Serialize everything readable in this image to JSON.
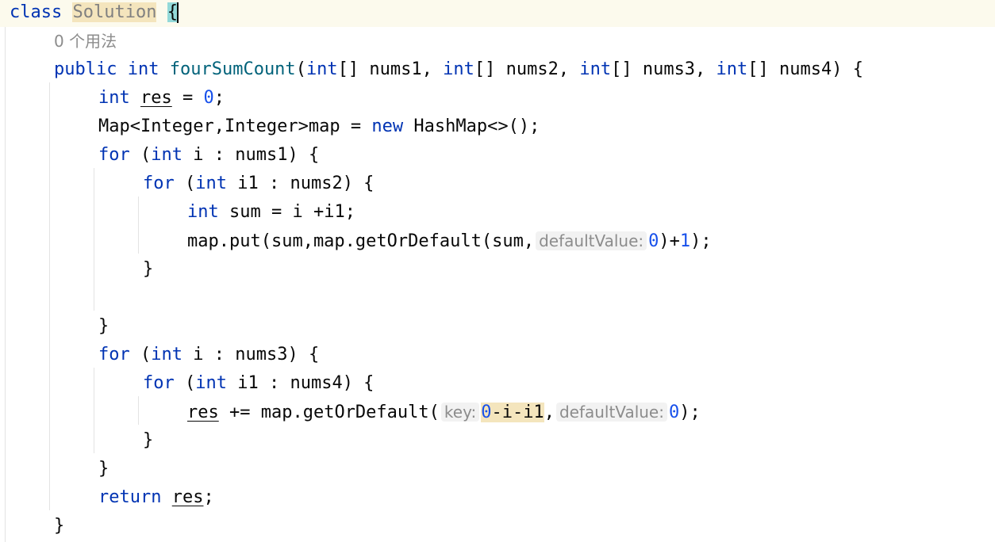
{
  "editor": {
    "lines": [
      {
        "kw": "class",
        "class_name": "Solution",
        "open_brace": "{"
      },
      {
        "usages": "0 个用法"
      },
      {
        "mod": "public",
        "ret": "int",
        "method": "fourSumCount",
        "p_open": "(",
        "t1": "int",
        "a1": "[] nums1, ",
        "t2": "int",
        "a2": "[] nums2, ",
        "t3": "int",
        "a3": "[] nums3, ",
        "t4": "int",
        "a4": "[] nums4) {"
      },
      {
        "type": "int",
        "var": "res",
        "mid": " = ",
        "num": "0",
        "end": ";"
      },
      {
        "pre": "Map<Integer,Integer>map = ",
        "kw": "new",
        "post": " HashMap<>();"
      },
      {
        "kw": "for",
        "p1": " (",
        "type": "int",
        "rest": " i : nums1) {"
      },
      {
        "kw": "for",
        "p1": " (",
        "type": "int",
        "rest": " i1 : nums2) {"
      },
      {
        "type": "int",
        "rest": " sum = i +i1;"
      },
      {
        "pre": "map.put(sum,map.getOrDefault(sum,",
        "hint": "defaultValue:",
        "num1": "0",
        "mid": ")+",
        "num2": "1",
        "end": ");"
      },
      {
        "text": "}"
      },
      {
        "text": ""
      },
      {
        "text": "}"
      },
      {
        "kw": "for",
        "p1": " (",
        "type": "int",
        "rest": " i : nums3) {"
      },
      {
        "kw": "for",
        "p1": " (",
        "type": "int",
        "rest": " i1 : nums4) {"
      },
      {
        "var": "res",
        "pre": " += map.getOrDefault(",
        "hint1": "key:",
        "num1": "0",
        "expr": "-i-i1",
        "comma": ",",
        "hint2": "defaultValue:",
        "num2": "0",
        "end": ");"
      },
      {
        "text": "}"
      },
      {
        "text": "}"
      },
      {
        "kw": "return",
        "var": "res",
        "end": ";"
      },
      {
        "text": "}"
      }
    ]
  },
  "colors": {
    "keyword": "#0033b3",
    "number": "#1750eb",
    "method_declaration": "#00627a",
    "hint_text": "#8c8c8c",
    "hint_background": "#f2f2f2",
    "highlight_background": "#f4e5bd",
    "brace_match": "#93d9d9",
    "caret_line": "#fcfaed",
    "indent_guide": "#e3e3e3"
  }
}
